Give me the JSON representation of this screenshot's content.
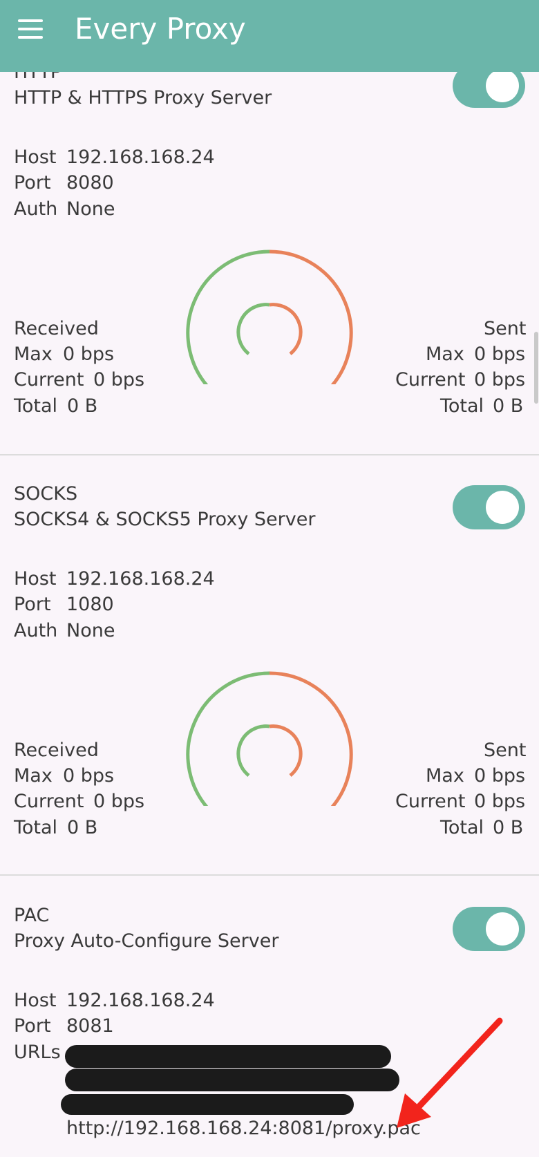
{
  "appbar": {
    "title": "Every Proxy",
    "menu_icon": "menu-icon"
  },
  "colors": {
    "appbar": "#6bb6aa",
    "toggle_on": "#6bb6aa",
    "gauge_received": "#7cbc74",
    "gauge_sent": "#e8825a",
    "annotation_arrow": "#f2241c"
  },
  "http": {
    "title": "HTTP",
    "subtitle": "HTTP & HTTPS Proxy Server",
    "enabled": true,
    "host_label": "Host",
    "host": "192.168.168.24",
    "port_label": "Port",
    "port": "8080",
    "auth_label": "Auth",
    "auth": "None",
    "received": {
      "label": "Received",
      "max_label": "Max",
      "max": "0 bps",
      "current_label": "Current",
      "current": "0 bps",
      "total_label": "Total",
      "total": "0 B"
    },
    "sent": {
      "label": "Sent",
      "max_label": "Max",
      "max": "0 bps",
      "current_label": "Current",
      "current": "0 bps",
      "total_label": "Total",
      "total": "0 B"
    }
  },
  "socks": {
    "title": "SOCKS",
    "subtitle": "SOCKS4 & SOCKS5 Proxy Server",
    "enabled": true,
    "host_label": "Host",
    "host": "192.168.168.24",
    "port_label": "Port",
    "port": "1080",
    "auth_label": "Auth",
    "auth": "None",
    "received": {
      "label": "Received",
      "max_label": "Max",
      "max": "0 bps",
      "current_label": "Current",
      "current": "0 bps",
      "total_label": "Total",
      "total": "0 B"
    },
    "sent": {
      "label": "Sent",
      "max_label": "Max",
      "max": "0 bps",
      "current_label": "Current",
      "current": "0 bps",
      "total_label": "Total",
      "total": "0 B"
    }
  },
  "pac": {
    "title": "PAC",
    "subtitle": "Proxy Auto-Configure Server",
    "enabled": true,
    "host_label": "Host",
    "host": "192.168.168.24",
    "port_label": "Port",
    "port": "8081",
    "urls_label": "URLs",
    "url_visible": "http://192.168.168.24:8081/proxy.pac"
  }
}
